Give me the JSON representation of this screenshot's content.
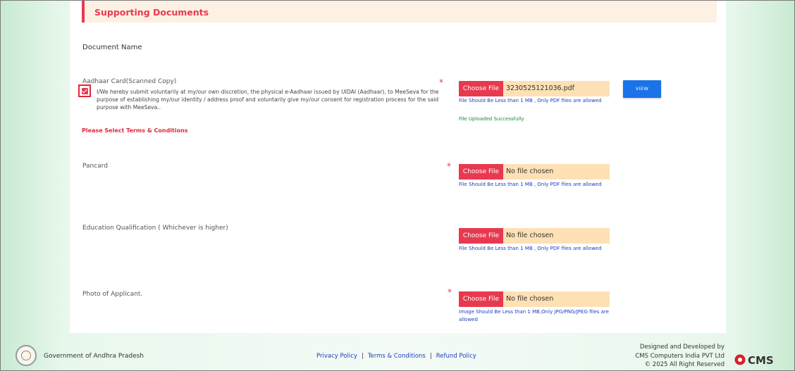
{
  "section": {
    "title": "Supporting Documents"
  },
  "doc_name_header": "Document Name",
  "documents": [
    {
      "label": "Aadhaar Card(Scanned Copy)",
      "required": true,
      "file_button": "Choose File",
      "file_name": "3230525121036.pdf",
      "hint": "File Should Be Less than 1 MB , Only PDF files are allowed",
      "status": "File Uploaded Successfully",
      "view_label": "VIEW",
      "consent_text": "I/We hereby submit voluntarily at my/our own discretion, the physical e-Aadhaar issued by UIDAI (Aadhaar), to MeeSeva for the purpose of establishing my/our identity / address proof and voluntarily give my/our consent for registration process for the said purpose with MeeSeva..",
      "consent_checked": true,
      "terms_error": "Please Select Terms & Conditions"
    },
    {
      "label": "Pancard",
      "required": true,
      "file_button": "Choose File",
      "file_name": "No file chosen",
      "hint": "File Should Be Less than 1 MB , Only PDF files are allowed"
    },
    {
      "label": "Education Qualification ( Whichever is higher)",
      "required": false,
      "file_button": "Choose File",
      "file_name": "No file chosen",
      "hint": "File Should Be Less than 1 MB , Only PDF files are allowed"
    },
    {
      "label": "Photo of Applicant.",
      "required": true,
      "file_button": "Choose File",
      "file_name": "No file chosen",
      "hint": "Image Should Be Less than 1 MB,Only JPG/PNG/JPEG files are allowed"
    }
  ],
  "footer": {
    "government": "Government of Andhra Pradesh",
    "links": [
      "Privacy Policy",
      "Terms & Conditions",
      "Refund Policy"
    ],
    "credit_line1": "Designed and Developed by",
    "credit_line2": "CMS Computers India PVT Ltd",
    "credit_line3": "© 2025 All Right Reserved",
    "logo_text": "CMS"
  },
  "colors": {
    "accent": "#e8394f",
    "link": "#1a3ec2",
    "success": "#198c2c",
    "view_button": "#1a73e8",
    "file_field": "#fde1b5"
  }
}
